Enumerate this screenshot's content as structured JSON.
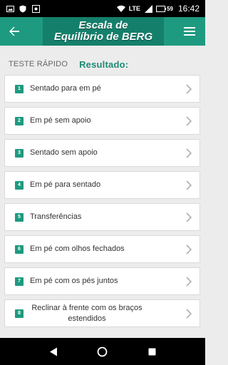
{
  "status_bar": {
    "time": "16:42",
    "network": "LTE",
    "battery_level": "59",
    "icons": [
      "photo-icon",
      "shield-icon",
      "image-icon",
      "wifi-icon",
      "signal-icon",
      "battery-icon"
    ]
  },
  "app_bar": {
    "title_line1": "Escala de",
    "title_line2": "Equilíbrio de BERG",
    "back_icon": "arrow-left-icon",
    "menu_icon": "hamburger-menu-icon",
    "accent_color": "#1e9a80"
  },
  "tabs": {
    "quick_test": "TESTE RÁPIDO",
    "result": "Resultado:"
  },
  "items": [
    {
      "number": "1",
      "label": "Sentado para em pé"
    },
    {
      "number": "2",
      "label": "Em pé sem apoio"
    },
    {
      "number": "3",
      "label": "Sentado sem apoio"
    },
    {
      "number": "4",
      "label": "Em pé para sentado"
    },
    {
      "number": "5",
      "label": "Transferências"
    },
    {
      "number": "6",
      "label": "Em pé com olhos fechados"
    },
    {
      "number": "7",
      "label": "Em pé com os pés juntos"
    },
    {
      "number": "8",
      "label_line1": "Reclinar à frente com os braços",
      "label_line2": "estendidos"
    }
  ],
  "nav_bar": {
    "icons": [
      "back-triangle-icon",
      "home-circle-icon",
      "recents-square-icon"
    ]
  }
}
